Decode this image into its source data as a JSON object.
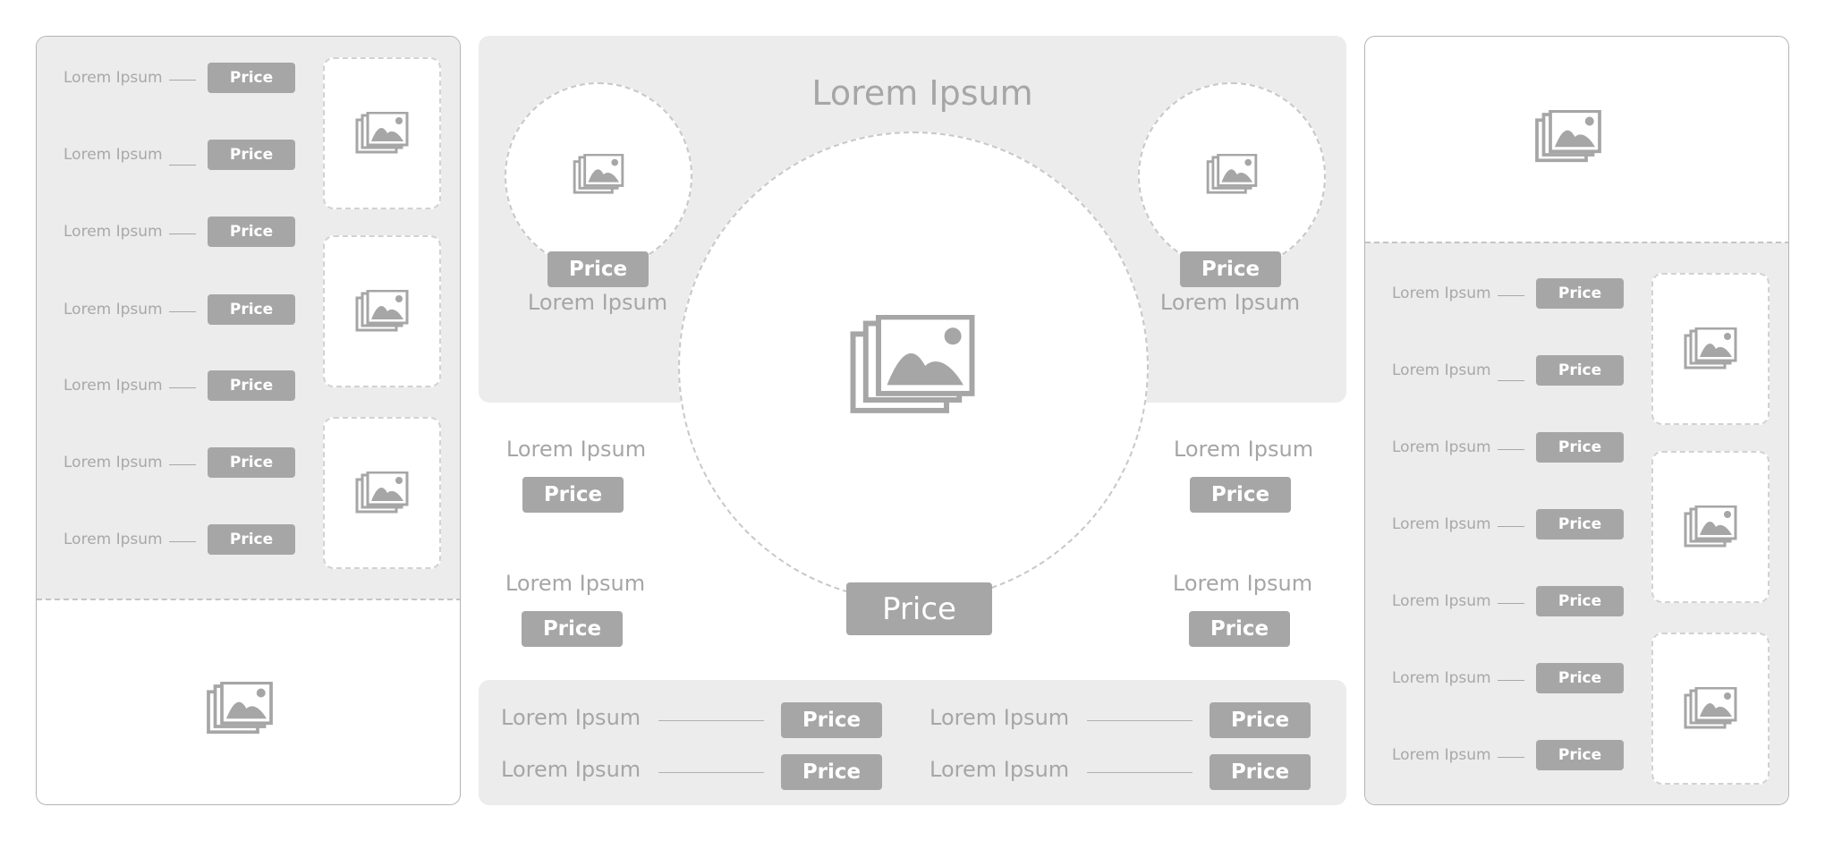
{
  "menu_left": {
    "items": [
      {
        "label": "Lorem Ipsum",
        "price": "Price"
      },
      {
        "label": "Lorem Ipsum",
        "price": "Price"
      },
      {
        "label": "Lorem Ipsum",
        "price": "Price"
      },
      {
        "label": "Lorem Ipsum",
        "price": "Price"
      },
      {
        "label": "Lorem Ipsum",
        "price": "Price"
      },
      {
        "label": "Lorem Ipsum",
        "price": "Price"
      },
      {
        "label": "Lorem Ipsum",
        "price": "Price"
      }
    ]
  },
  "menu_right": {
    "items": [
      {
        "label": "Lorem Ipsum",
        "price": "Price"
      },
      {
        "label": "Lorem Ipsum",
        "price": "Price"
      },
      {
        "label": "Lorem Ipsum",
        "price": "Price"
      },
      {
        "label": "Lorem Ipsum",
        "price": "Price"
      },
      {
        "label": "Lorem Ipsum",
        "price": "Price"
      },
      {
        "label": "Lorem Ipsum",
        "price": "Price"
      },
      {
        "label": "Lorem Ipsum",
        "price": "Price"
      }
    ]
  },
  "center": {
    "title": "Lorem Ipsum",
    "circle_left": {
      "label": "Lorem Ipsum",
      "price": "Price"
    },
    "circle_right": {
      "label": "Lorem Ipsum",
      "price": "Price"
    },
    "hero_price": "Price",
    "side_items": [
      {
        "label": "Lorem Ipsum",
        "price": "Price"
      },
      {
        "label": "Lorem Ipsum",
        "price": "Price"
      },
      {
        "label": "Lorem Ipsum",
        "price": "Price"
      },
      {
        "label": "Lorem Ipsum",
        "price": "Price"
      }
    ],
    "bottom_items": [
      {
        "label": "Lorem Ipsum",
        "price": "Price"
      },
      {
        "label": "Lorem Ipsum",
        "price": "Price"
      },
      {
        "label": "Lorem Ipsum",
        "price": "Price"
      },
      {
        "label": "Lorem Ipsum",
        "price": "Price"
      }
    ]
  },
  "icons": {
    "image_placeholder": "image-stack-icon"
  },
  "colors": {
    "panel_fill": "#ececec",
    "price_badge": "#a6a6a6",
    "text": "#a6a6a6"
  }
}
